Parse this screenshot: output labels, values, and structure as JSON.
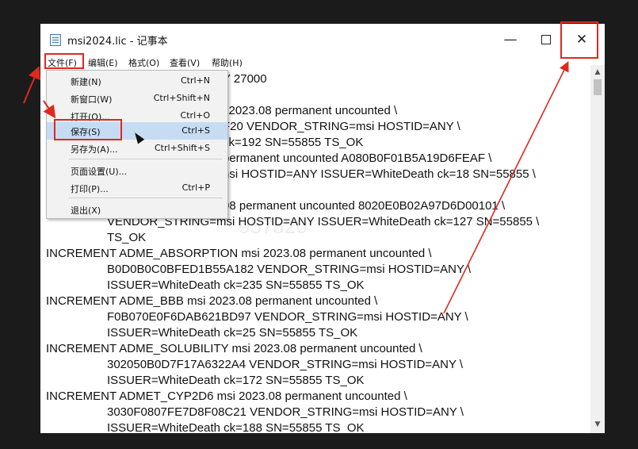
{
  "window": {
    "title": "msi2024.lic - 记事本",
    "minimize_label": "—",
    "close_label": "✕"
  },
  "menubar": [
    "文件(F)",
    "编辑(E)",
    "格式(O)",
    "查看(V)",
    "帮助(H)"
  ],
  "file_menu": {
    "items": [
      {
        "label": "新建(N)",
        "shortcut": "Ctrl+N"
      },
      {
        "label": "新窗口(W)",
        "shortcut": "Ctrl+Shift+N"
      },
      {
        "label": "打开(O)...",
        "shortcut": "Ctrl+O"
      },
      {
        "label": "保存(S)",
        "shortcut": "Ctrl+S"
      },
      {
        "label": "另存为(A)...",
        "shortcut": "Ctrl+Shift+S"
      },
      {
        "label": "页面设置(U)...",
        "shortcut": ""
      },
      {
        "label": "打印(P)...",
        "shortcut": "Ctrl+P"
      },
      {
        "label": "退出(X)",
        "shortcut": ""
      }
    ],
    "highlighted_item": "保存(S)"
  },
  "editor": {
    "lines": [
      "Y 27000",
      "",
      "i 2023.08 permanent uncounted \\",
      "F20 VENDOR_STRING=msi HOSTID=ANY \\",
      "ck=192 SN=55855 TS_OK",
      "permanent uncounted A080B0F01B5A19D6FEAF \\",
      "nsi HOSTID=ANY ISSUER=WhiteDeath ck=18 SN=55855 \\",
      "",
      "08 permanent uncounted 8020E0B02A97D6D00101 \\",
      "VENDOR_STRING=msi HOSTID=ANY ISSUER=WhiteDeath ck=127 SN=55855 \\",
      "TS_OK",
      "INCREMENT ADME_ABSORPTION msi 2023.08 permanent uncounted \\",
      "B0D0B0C0BFED1B55A182 VENDOR_STRING=msi HOSTID=ANY \\",
      "ISSUER=WhiteDeath ck=235 SN=55855 TS_OK",
      "INCREMENT ADME_BBB msi 2023.08 permanent uncounted \\",
      "F0B070E0F6DAB621BD97 VENDOR_STRING=msi HOSTID=ANY \\",
      "ISSUER=WhiteDeath ck=25 SN=55855 TS_OK",
      "INCREMENT ADME_SOLUBILITY msi 2023.08 permanent uncounted \\",
      "302050B0D7F17A6322A4 VENDOR_STRING=msi HOSTID=ANY \\",
      "ISSUER=WhiteDeath ck=172 SN=55855 TS_OK",
      "INCREMENT ADMET_CYP2D6 msi 2023.08 permanent uncounted \\",
      "3030F0807FE7D8F08C21 VENDOR_STRING=msi HOSTID=ANY \\",
      "ISSUER=WhiteDeath ck=188 SN=55855 TS_OK"
    ],
    "watermark": "957820"
  },
  "colors": {
    "annotation_red": "#e0281f",
    "menu_highlight": "#c6dcf3",
    "background": "#1b1b1b"
  },
  "icons": {
    "app": "notepad-icon",
    "pointer": "mouse-cursor-icon"
  }
}
